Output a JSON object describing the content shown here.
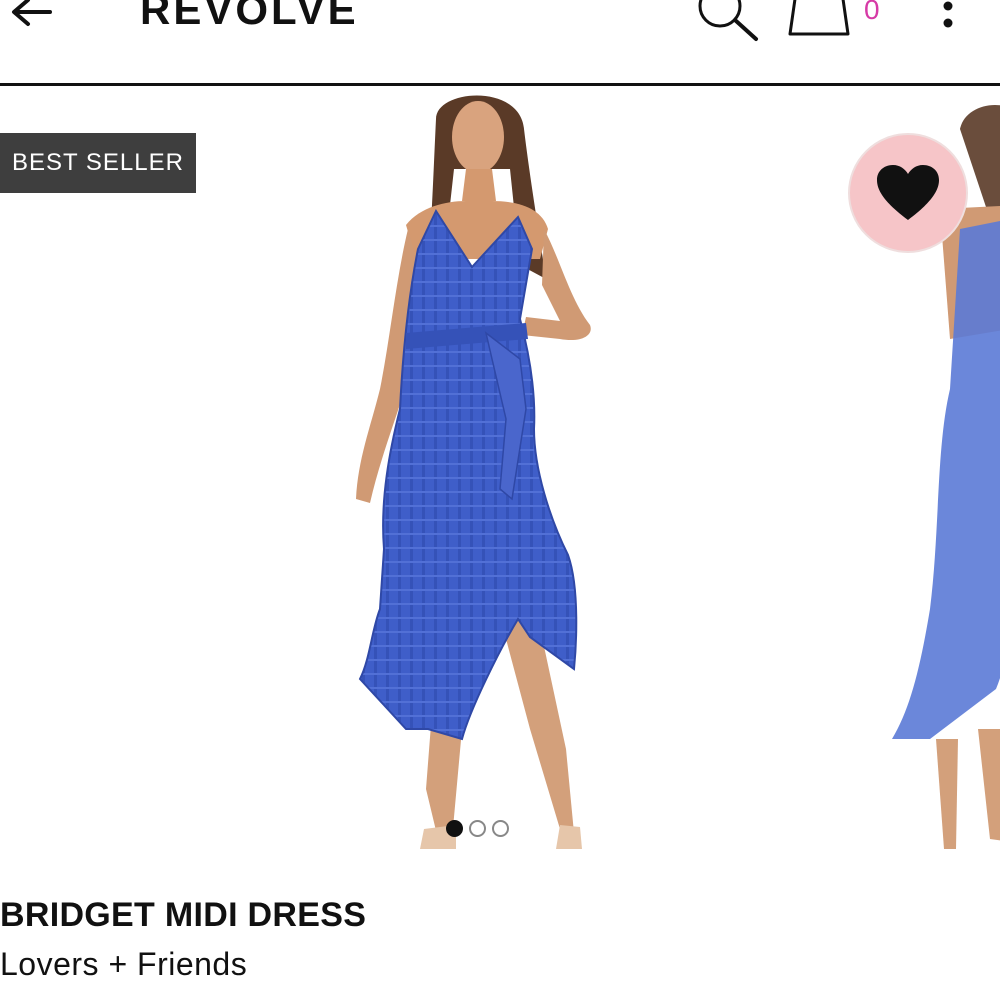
{
  "header": {
    "logo": "REVOLVE",
    "bag_count": "0",
    "icons": [
      "back-arrow-icon",
      "search-icon",
      "shopping-bag-icon",
      "more-vertical-icon"
    ]
  },
  "product": {
    "badge": "BEST SELLER",
    "title": "BRIDGET MIDI DRESS",
    "brand": "Lovers + Friends",
    "image_count": 3,
    "active_image_index": 0,
    "dress_color": "#3f5ec9"
  },
  "colors": {
    "bag_count": "#d63aa6",
    "badge_bg": "#3e3e3e",
    "wishlist_bg": "#f6c5c8"
  }
}
